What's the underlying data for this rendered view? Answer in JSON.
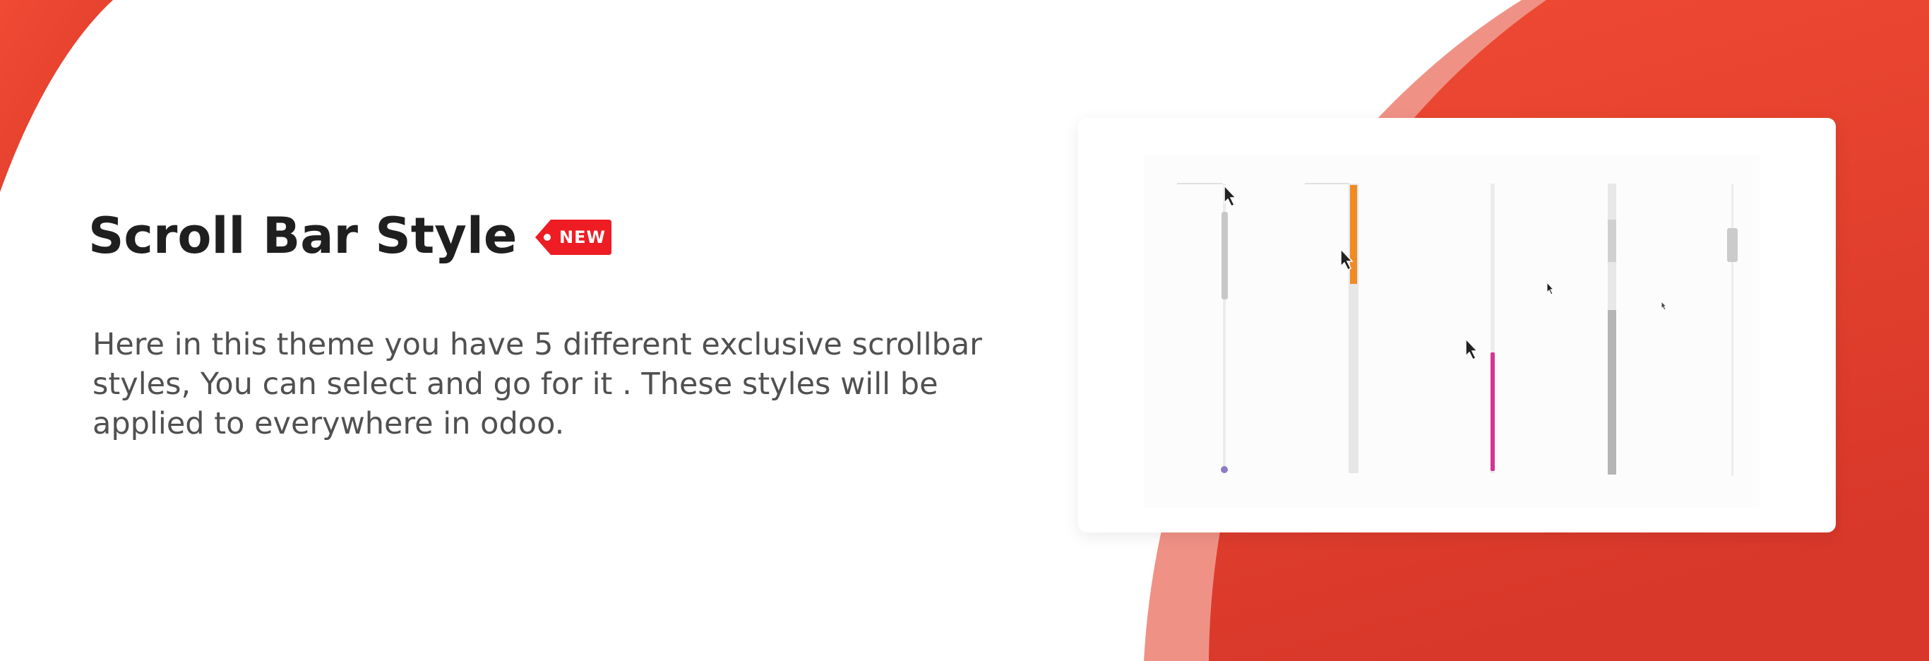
{
  "feature": {
    "title": "Scroll Bar Style",
    "badge": "NEW",
    "description": "Here in this theme you have 5 different exclusive scrollbar styles, You can select and go for it . These styles will be applied to everywhere in odoo."
  },
  "colors": {
    "accent_red": "#e53a2b",
    "badge_red": "#ee1d24",
    "heading": "#1f1f1f",
    "body_text": "#505050",
    "style_1_thumb": "#c8c8c8",
    "style_1_knob": "#8e7cc3",
    "style_2_thumb": "#f08a24",
    "style_3_thumb": "#d6348f",
    "style_4_thumb": "#b5b5b5",
    "style_5_thumb": "#cbcbcb"
  },
  "preview": {
    "scrollbar_styles": [
      {
        "name": "scrollbar-style-1",
        "icon": "mouse-cursor-icon"
      },
      {
        "name": "scrollbar-style-2",
        "icon": "mouse-cursor-icon"
      },
      {
        "name": "scrollbar-style-3",
        "icon": "mouse-cursor-icon"
      },
      {
        "name": "scrollbar-style-4",
        "icon": "mouse-cursor-icon"
      },
      {
        "name": "scrollbar-style-5",
        "icon": "mouse-cursor-icon"
      }
    ]
  }
}
